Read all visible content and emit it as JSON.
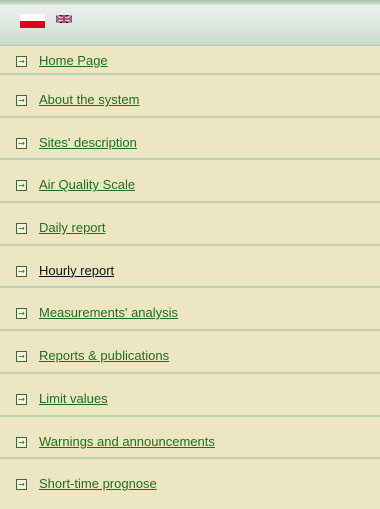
{
  "languages": [
    "PL",
    "EN"
  ],
  "menu": {
    "items": [
      {
        "label": "Home Page"
      },
      {
        "label": "About the system"
      },
      {
        "label": "Sites' description"
      },
      {
        "label": "Air Quality Scale"
      },
      {
        "label": "Daily report"
      },
      {
        "label": "Hourly report"
      },
      {
        "label": "Measurements' analysis"
      },
      {
        "label": "Reports & publications"
      },
      {
        "label": "Limit values"
      },
      {
        "label": "Warnings and announcements"
      },
      {
        "label": "Short-time prognose"
      }
    ],
    "active_index": 5
  },
  "colors": {
    "background": "#ece7c2",
    "link": "#1f6e1f",
    "link_active": "#111111",
    "divider": "#b8d3b8"
  },
  "icons": {
    "item_bullet": "arrow-into-box-icon"
  }
}
